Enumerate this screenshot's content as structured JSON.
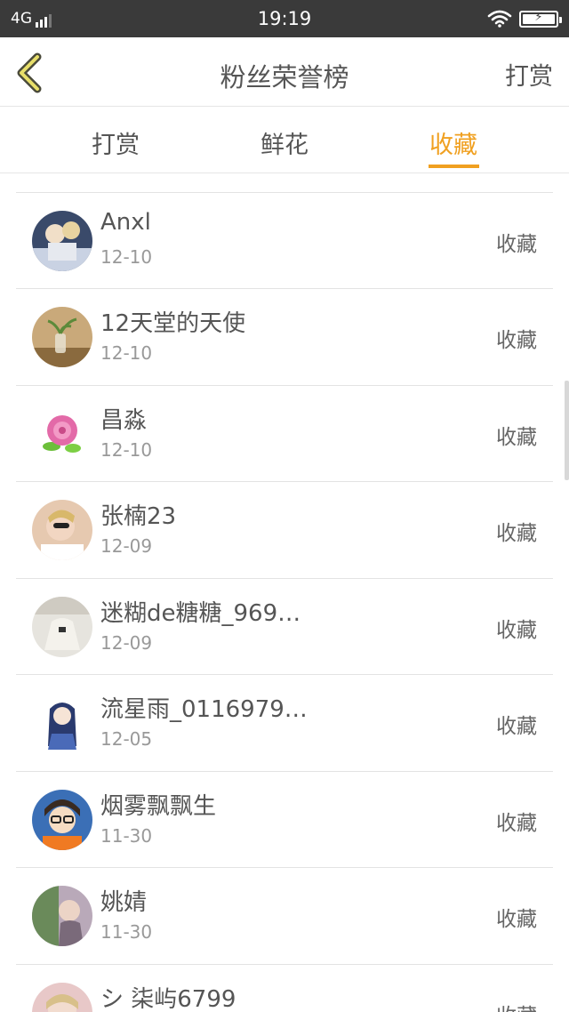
{
  "status_bar": {
    "network": "4G",
    "time": "19:19"
  },
  "nav": {
    "title": "粉丝荣誉榜",
    "action": "打赏"
  },
  "tabs": [
    {
      "label": "打赏"
    },
    {
      "label": "鲜花"
    },
    {
      "label": "收藏"
    }
  ],
  "active_tab": "收藏",
  "colors": {
    "accent": "#f0a020",
    "status_bar": "#3a3a3a",
    "text": "#555555",
    "date": "#999999"
  },
  "list": [
    {
      "name": "",
      "date": "12-10",
      "action": ""
    },
    {
      "name": "Anxl",
      "date": "12-10",
      "action": "收藏"
    },
    {
      "name": "12天堂的天使",
      "date": "12-10",
      "action": "收藏"
    },
    {
      "name": "昌淼",
      "date": "12-10",
      "action": "收藏"
    },
    {
      "name": "张楠23",
      "date": "12-09",
      "action": "收藏"
    },
    {
      "name": "迷糊de糖糖_969…",
      "date": "12-09",
      "action": "收藏"
    },
    {
      "name": "流星雨_0116979…",
      "date": "12-05",
      "action": "收藏"
    },
    {
      "name": "烟雾飘飘生",
      "date": "11-30",
      "action": "收藏"
    },
    {
      "name": "姚婧",
      "date": "11-30",
      "action": "收藏"
    },
    {
      "name": "シ 柒屿6799",
      "date": "",
      "action": "收藏"
    }
  ]
}
